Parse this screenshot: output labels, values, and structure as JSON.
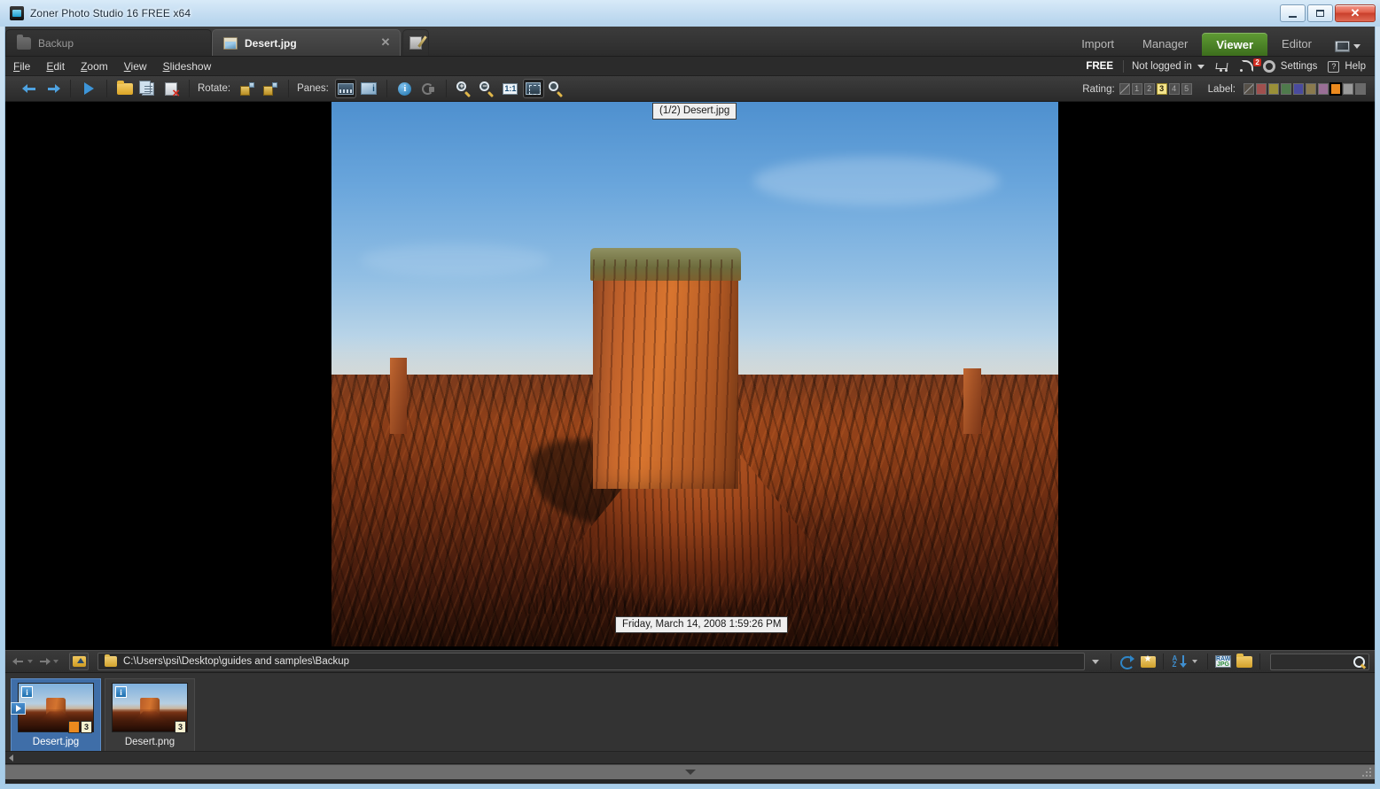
{
  "window": {
    "title": "Zoner Photo Studio 16 FREE x64",
    "app_icon": "camera-icon",
    "controls": {
      "minimize": "–",
      "maximize": "▭",
      "close": "✕"
    }
  },
  "tabs": [
    {
      "label": "Backup",
      "icon": "folder-icon",
      "active": false,
      "closable": false
    },
    {
      "label": "Desert.jpg",
      "icon": "photo-icon",
      "active": true,
      "closable": true,
      "close_glyph": "✕"
    }
  ],
  "tab_editor_button": {
    "name": "open-in-editor",
    "icon": "edit-icon"
  },
  "module_nav": {
    "items": [
      {
        "label": "Import",
        "active": false
      },
      {
        "label": "Manager",
        "active": false
      },
      {
        "label": "Viewer",
        "active": true
      },
      {
        "label": "Editor",
        "active": false
      }
    ],
    "active_color": "#4a8026",
    "screen_mode_icon": "monitor-icon"
  },
  "menu": {
    "items": [
      {
        "label": "File",
        "accel": "F"
      },
      {
        "label": "Edit",
        "accel": "E"
      },
      {
        "label": "Zoom",
        "accel": "Z"
      },
      {
        "label": "View",
        "accel": "V"
      },
      {
        "label": "Slideshow",
        "accel": "S"
      }
    ],
    "right": {
      "license": "FREE",
      "account": "Not logged in",
      "cart_icon": "shopping-cart-icon",
      "rss_icon": "rss-feed-icon",
      "rss_badge": "2",
      "rss_badge_color": "#cf2b20",
      "settings": "Settings",
      "settings_icon": "gear-icon",
      "help": "Help",
      "help_icon": "question-mark-icon"
    }
  },
  "toolbar": {
    "back": "Back",
    "forward": "Forward",
    "slideshow": "Start slideshow",
    "open": "Open",
    "copy": "Copy",
    "delete": "Delete",
    "rotate_label": "Rotate:",
    "rotate_left": "Rotate left",
    "rotate_right": "Rotate right",
    "panes_label": "Panes:",
    "panes_filmstrip": "Filmstrip pane",
    "panes_info": "Information pane",
    "info": "Information",
    "history": "History",
    "zoom_in": "Zoom in",
    "zoom_out": "Zoom out",
    "zoom_actual": "1:1",
    "zoom_fit": "Fit to window",
    "zoom_last": "Last zoom",
    "zoom_in_glyph": "+",
    "zoom_out_glyph": "−"
  },
  "rating": {
    "label": "Rating:",
    "options": [
      "⁄",
      "1",
      "2",
      "3",
      "4",
      "5"
    ],
    "selected": "3",
    "selected_color": "#f4e48c"
  },
  "label_colors": {
    "label": "Label:",
    "swatches": [
      "none",
      "#a0504e",
      "#9a9038",
      "#4f7a4c",
      "#4a4b9e",
      "#8a7a4e",
      "#9a6f96",
      "#ec8a1e",
      "#9a9a9a",
      "#6a6a6a"
    ],
    "active": "#ec8a1e",
    "active_index": 7
  },
  "viewer": {
    "tooltip": "(1/2) Desert.jpg",
    "date_overlay": "Friday, March 14, 2008 1:59:26 PM",
    "image_name": "Desert.jpg",
    "background": "#000000"
  },
  "pathbar": {
    "back_icon": "back-arrow-icon",
    "forward_icon": "forward-arrow-icon",
    "up_icon": "folder-up-icon",
    "folder_icon": "folder-icon",
    "path": "C:\\Users\\psi\\Desktop\\guides and samples\\Backup",
    "dropdown_icon": "chevron-down-icon",
    "refresh_icon": "refresh-icon",
    "favorites_icon": "favorite-folder-icon",
    "sort_icon": "sort-az-icon",
    "rawjpg_icon": "raw-jpg-filter-icon",
    "newfolder_icon": "new-folder-icon",
    "search_value": "",
    "search_placeholder": "",
    "search_icon": "search-icon"
  },
  "filmstrip": {
    "items": [
      {
        "name": "Desert.jpg",
        "selected": true,
        "info_badge": "i",
        "arrow_badge": true,
        "rating_badge": "3",
        "color_badge": "#ec8a1e"
      },
      {
        "name": "Desert.png",
        "selected": false,
        "info_badge": "i",
        "arrow_badge": false,
        "rating_badge": "3",
        "color_badge": null
      }
    ],
    "scroll_left_icon": "chevron-left-icon"
  },
  "statusbar": {
    "expand_icon": "chevron-down-icon",
    "resize_grip": "resize-grip-icon"
  }
}
